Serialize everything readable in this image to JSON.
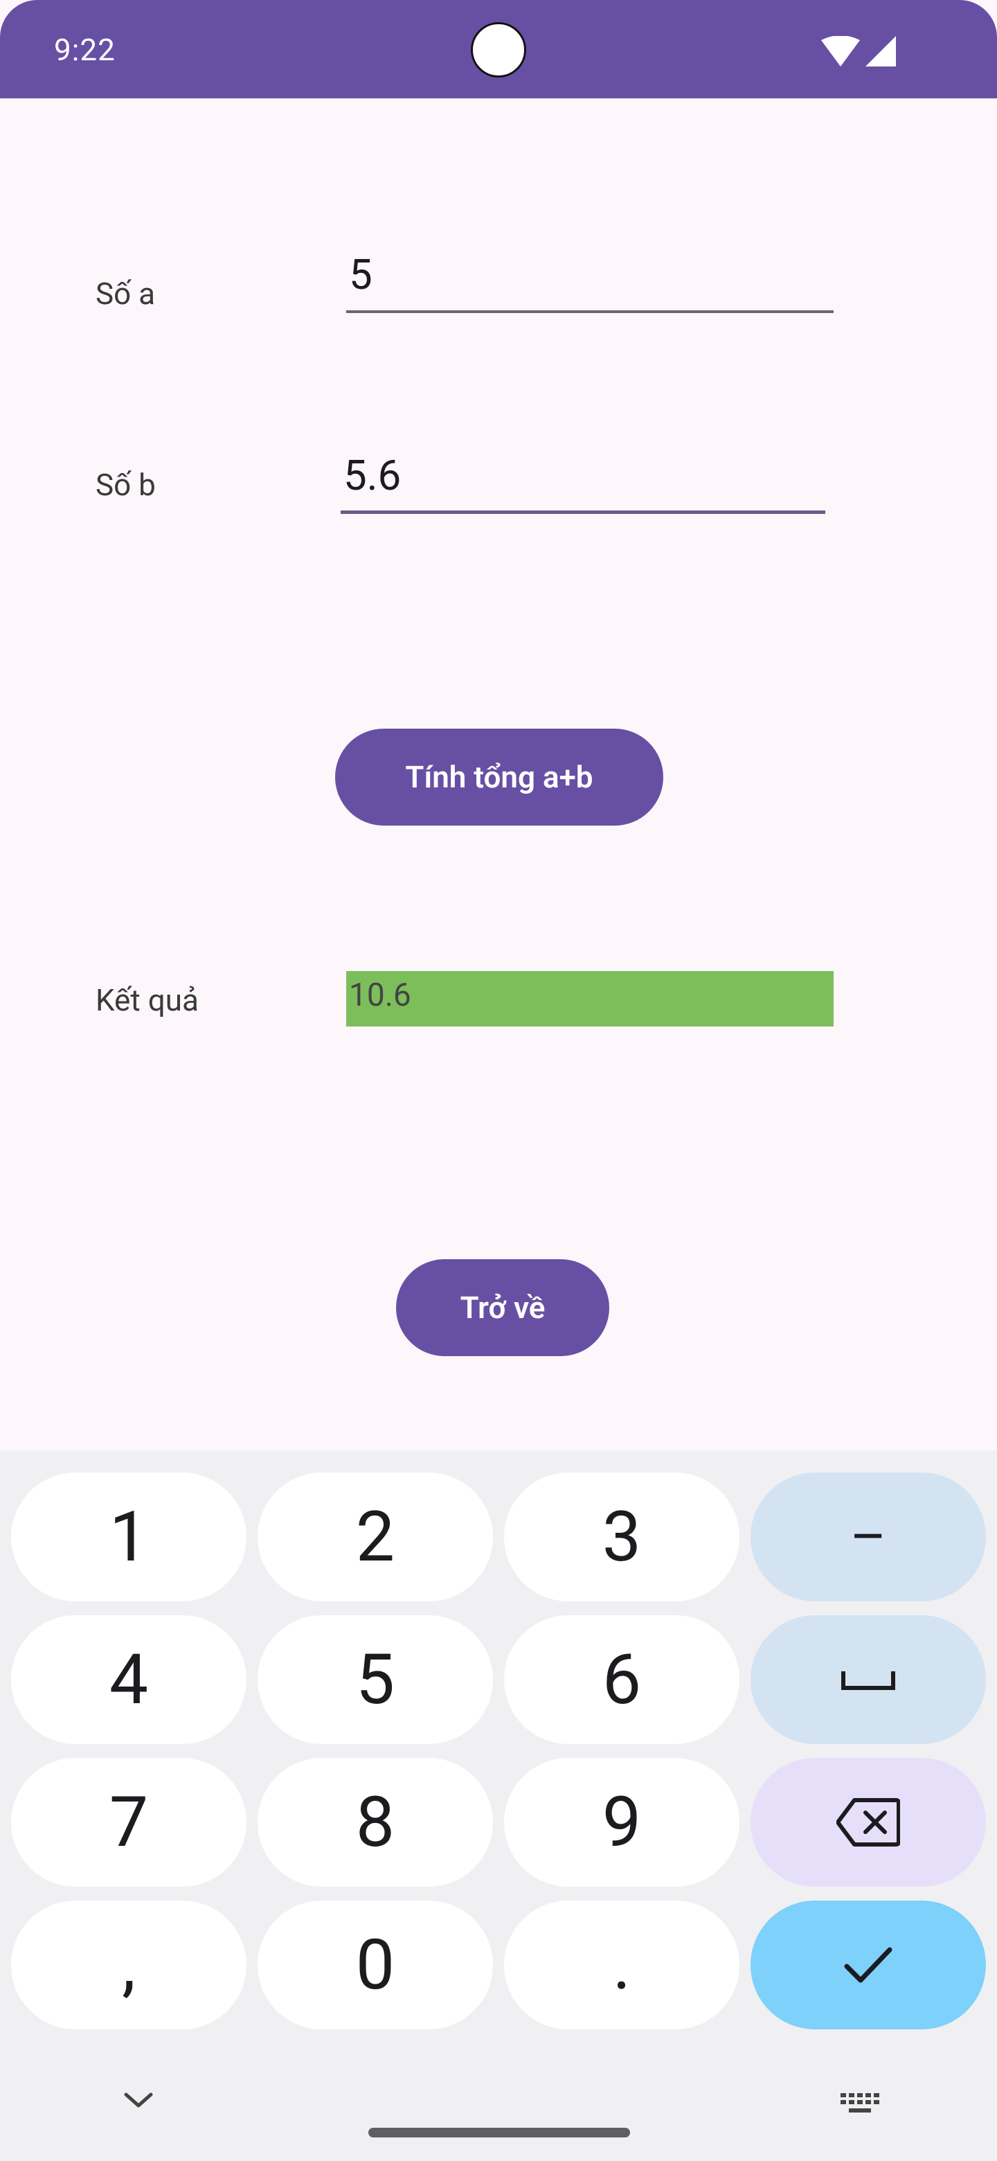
{
  "status_bar": {
    "time": "9:22",
    "color": "#6750a4"
  },
  "form": {
    "label_a": "Số a",
    "value_a": "5",
    "label_b": "Số b",
    "value_b": "5.6",
    "sum_button": "Tính tổng a+b",
    "result_label": "Kết quả",
    "result_value": "10.6",
    "result_bg": "#7cbf5a",
    "back_button": "Trở về"
  },
  "keyboard": {
    "rows": [
      [
        "1",
        "2",
        "3",
        "–"
      ],
      [
        "4",
        "5",
        "6",
        "space-icon"
      ],
      [
        "7",
        "8",
        "9",
        "backspace-icon"
      ],
      [
        ",",
        "0",
        ".",
        "check-icon"
      ]
    ]
  }
}
